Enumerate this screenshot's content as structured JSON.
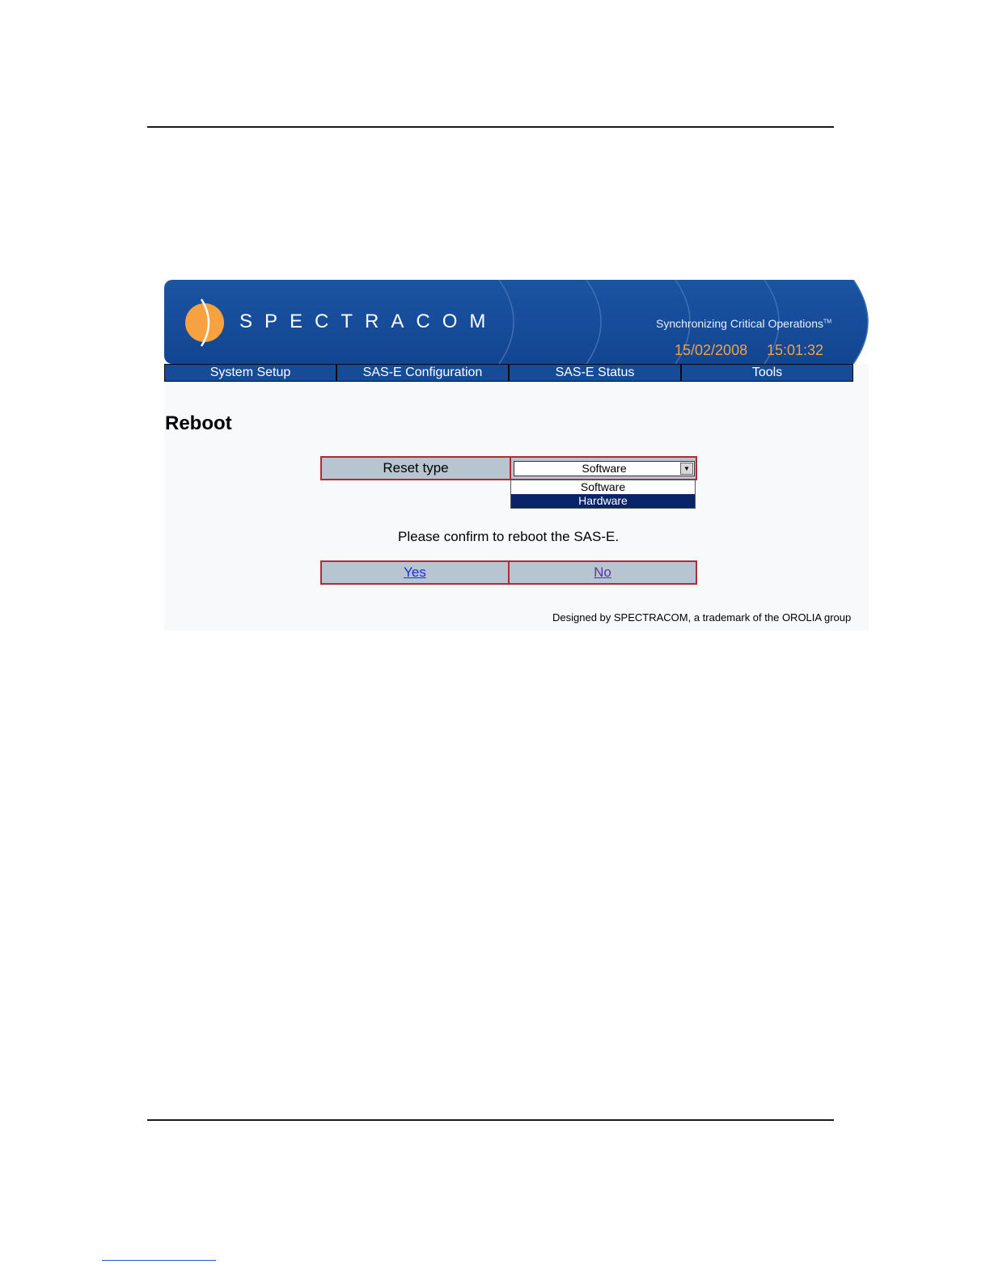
{
  "header": {
    "brand": "SPECTRACOM",
    "tagline": "Synchronizing Critical Operations",
    "trademark": "TM",
    "date": "15/02/2008",
    "time": "15:01:32",
    "colors": {
      "banner": "#124592",
      "datetime": "#f4a23c",
      "logo": "#f7a140"
    }
  },
  "nav": {
    "items": [
      {
        "label": "System Setup"
      },
      {
        "label": "SAS-E Configuration"
      },
      {
        "label": "SAS-E Status"
      },
      {
        "label": "Tools"
      }
    ]
  },
  "page": {
    "title": "Reboot",
    "reset": {
      "label": "Reset type",
      "selected_value": "Software",
      "options": [
        "Software",
        "Hardware"
      ],
      "highlighted_option": "Hardware"
    },
    "confirm_text": "Please confirm to reboot the SAS-E.",
    "yes_label": "Yes",
    "no_label": "No",
    "footer": "Designed by SPECTRACOM, a trademark of the OROLIA group"
  }
}
